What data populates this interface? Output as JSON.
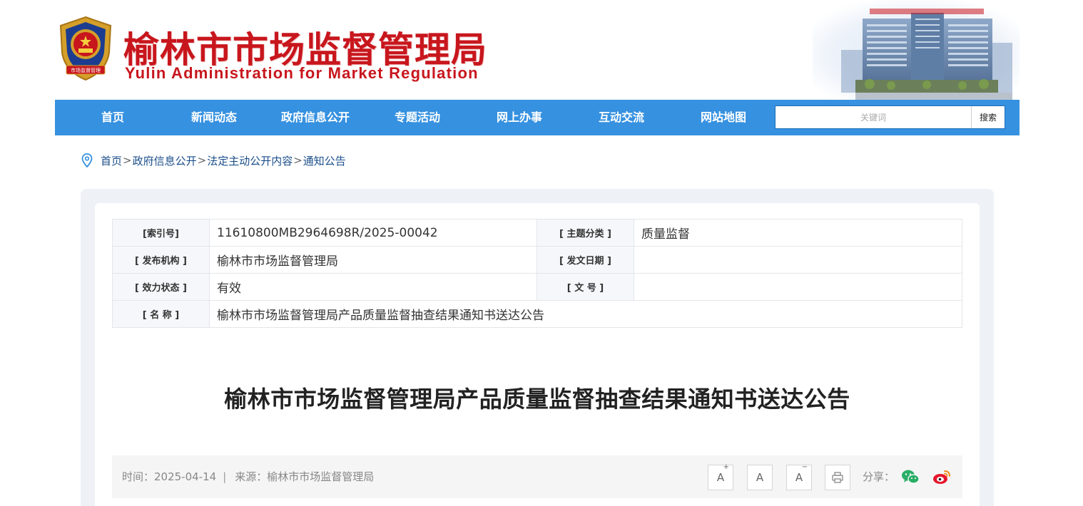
{
  "header": {
    "title_cn": "榆林市市场监督管理局",
    "title_en": "Yulin Administration for Market Regulation",
    "emblem_text": "市场监督管理"
  },
  "nav": {
    "items": [
      {
        "label": "首页"
      },
      {
        "label": "新闻动态"
      },
      {
        "label": "政府信息公开"
      },
      {
        "label": "专题活动"
      },
      {
        "label": "网上办事"
      },
      {
        "label": "互动交流"
      },
      {
        "label": "网站地图"
      }
    ],
    "search_placeholder": "关键词",
    "search_button": "搜索"
  },
  "breadcrumb": {
    "items": [
      "首页",
      "政府信息公开",
      "法定主动公开内容",
      "通知公告"
    ],
    "separator": ">"
  },
  "meta": {
    "index_label": "[索引号]",
    "index_value": "11610800MB2964698R/2025-00042",
    "topic_label": "[ 主题分类 ]",
    "topic_value": "质量监督",
    "publisher_label": "[ 发布机构 ]",
    "publisher_value": "榆林市市场监督管理局",
    "date_label": "[ 发文日期 ]",
    "date_value": "",
    "status_label": "[ 效力状态 ]",
    "status_value": "有效",
    "docno_label": "[ 文 号 ]",
    "docno_value": "",
    "name_label": "[ 名 称 ]",
    "name_value": "榆林市市场监督管理局产品质量监督抽查结果通知书送达公告"
  },
  "article": {
    "title": "榆林市市场监督管理局产品质量监督抽查结果通知书送达公告",
    "time_text": "时间：2025-04-14",
    "separator": "|",
    "source_text": "来源：榆林市市场监督管理局"
  },
  "tools": {
    "font_increase": "A",
    "font_increase_mark": "+",
    "font_normal": "A",
    "font_decrease": "A",
    "font_decrease_mark": "−",
    "share_label": "分享："
  },
  "colors": {
    "nav_bg": "#3691e0",
    "title_red": "#c8161d",
    "breadcrumb": "#1a4e8a",
    "wechat": "#2aae67",
    "weibo": "#e6162d"
  }
}
